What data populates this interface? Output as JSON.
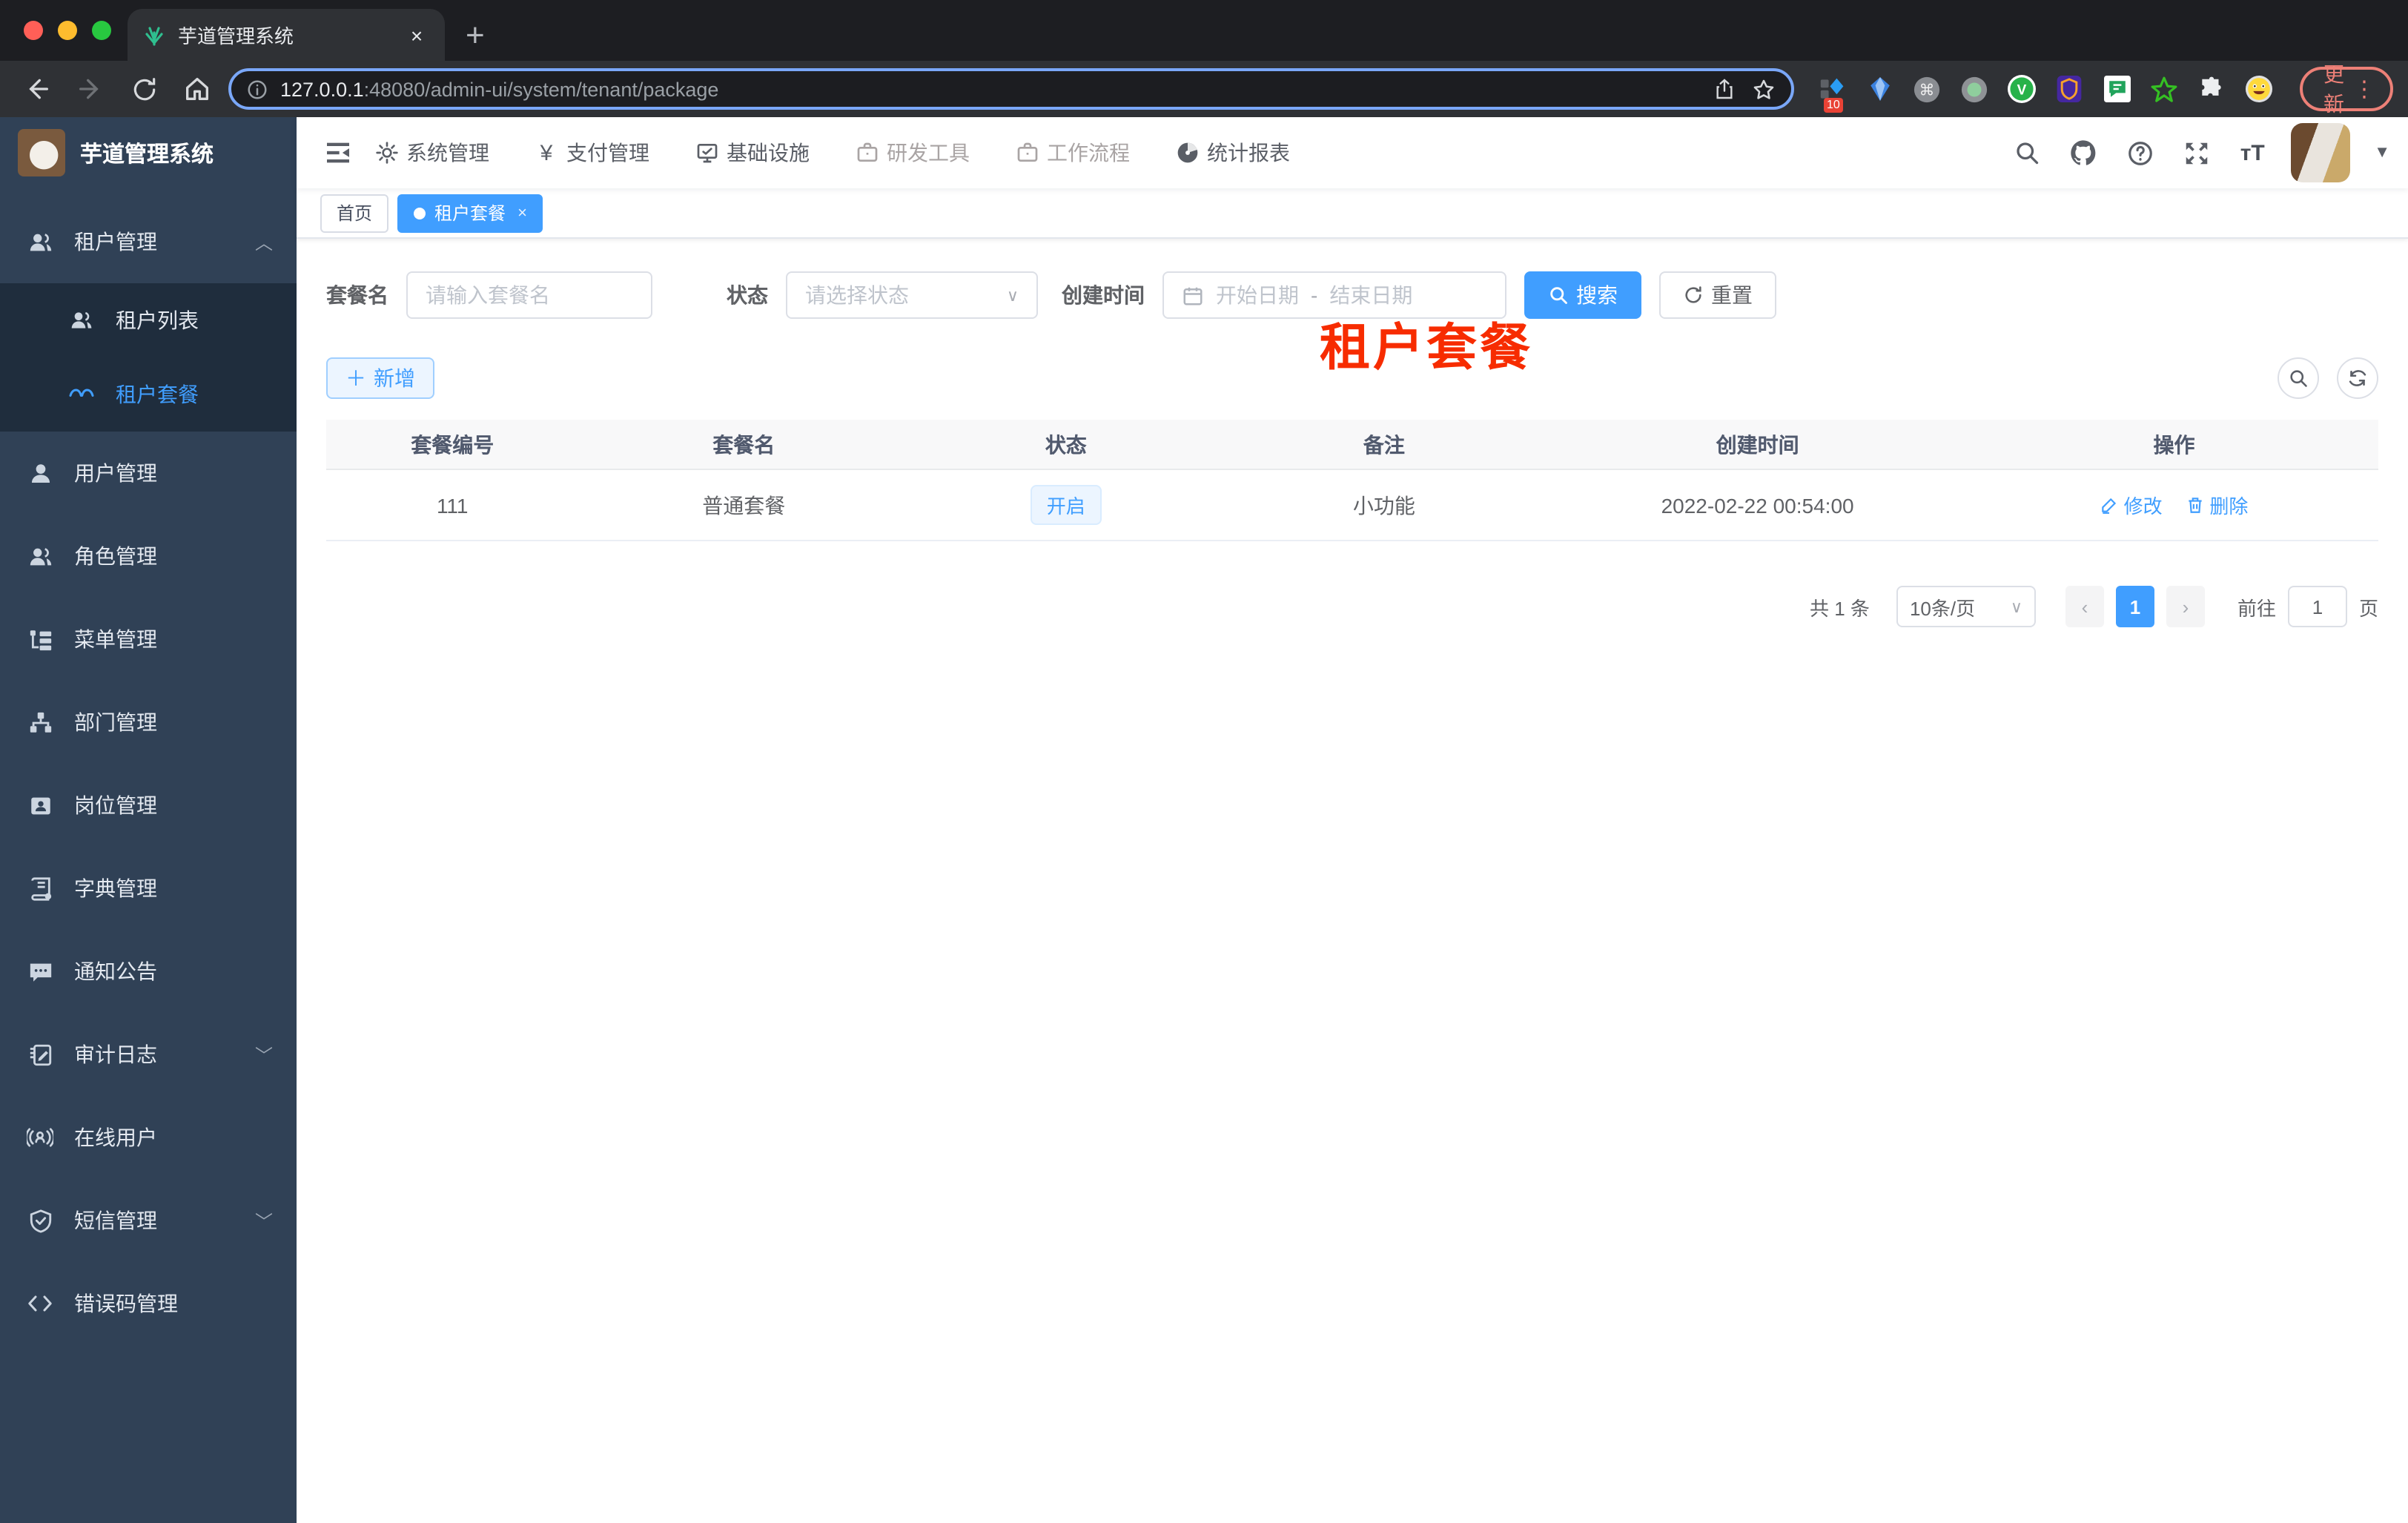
{
  "browser": {
    "tab_title": "芋道管理系统",
    "tab_close": "×",
    "new_tab": "+",
    "url_domain": "127.0.0.1",
    "url_path": ":48080/admin-ui/system/tenant/package",
    "update_button": "更新",
    "kebab": "⋮",
    "ext_badge": "10",
    "icons": [
      "back-icon",
      "forward-icon",
      "reload-icon",
      "home-icon",
      "site-info-icon",
      "share-icon",
      "star-icon",
      "extensions-puzzle-icon"
    ]
  },
  "app": {
    "logo_title": "芋道管理系统",
    "nav": {
      "items": [
        {
          "label": "系统管理",
          "icon": "gear-icon"
        },
        {
          "label": "支付管理",
          "icon": "yen-icon"
        },
        {
          "label": "基础设施",
          "icon": "monitor-icon"
        },
        {
          "label": "研发工具",
          "icon": "toolbox-icon"
        },
        {
          "label": "工作流程",
          "icon": "toolbox-icon"
        },
        {
          "label": "统计报表",
          "icon": "dashboard-icon"
        }
      ]
    },
    "header_icons": [
      "search-icon",
      "github-icon",
      "help-icon",
      "fullscreen-icon",
      "font-size-icon"
    ],
    "font_size_icon_text": "тT",
    "sidebar": {
      "items": [
        {
          "label": "租户管理",
          "icon": "users-icon",
          "chevron": "︿"
        },
        {
          "label": "租户列表",
          "icon": "users-icon"
        },
        {
          "label": "租户套餐",
          "icon": "glasses-icon",
          "active": true
        },
        {
          "label": "用户管理",
          "icon": "user-icon"
        },
        {
          "label": "角色管理",
          "icon": "users-icon"
        },
        {
          "label": "菜单管理",
          "icon": "tree-icon"
        },
        {
          "label": "部门管理",
          "icon": "org-icon"
        },
        {
          "label": "岗位管理",
          "icon": "badge-icon"
        },
        {
          "label": "字典管理",
          "icon": "book-icon"
        },
        {
          "label": "通知公告",
          "icon": "message-icon"
        },
        {
          "label": "审计日志",
          "icon": "log-icon",
          "chevron": "﹀"
        },
        {
          "label": "在线用户",
          "icon": "online-icon"
        },
        {
          "label": "短信管理",
          "icon": "shield-icon",
          "chevron": "﹀"
        },
        {
          "label": "错误码管理",
          "icon": "code-icon"
        }
      ]
    },
    "tags": {
      "home": "首页",
      "active": "租户套餐",
      "close": "×"
    },
    "page_title": "租户套餐",
    "filters": {
      "name_label": "套餐名",
      "name_placeholder": "请输入套餐名",
      "status_label": "状态",
      "status_placeholder": "请选择状态",
      "time_label": "创建时间",
      "start_placeholder": "开始日期",
      "separator": "-",
      "end_placeholder": "结束日期",
      "search_label": "搜索",
      "reset_label": "重置"
    },
    "toolbar": {
      "add_label": "新增"
    },
    "table": {
      "headers": [
        "套餐编号",
        "套餐名",
        "状态",
        "备注",
        "创建时间",
        "操作"
      ],
      "rows": [
        {
          "id": "111",
          "name": "普通套餐",
          "status": "开启",
          "remark": "小功能",
          "create_time": "2022-02-22 00:54:00",
          "edit": "修改",
          "delete": "删除"
        }
      ]
    },
    "pagination": {
      "total": "共 1 条",
      "page_size": "10条/页",
      "prev": "‹",
      "page": "1",
      "next": "›",
      "goto_label": "前往",
      "goto_value": "1",
      "page_suffix": "页"
    }
  },
  "colors": {
    "accent": "#409eff",
    "sidebar_bg": "#304156",
    "submenu_bg": "#1f2d3d",
    "page_title_red": "#f72c00",
    "status_tag_bg": "#ecf5ff",
    "update_chip": "#ed8077"
  }
}
